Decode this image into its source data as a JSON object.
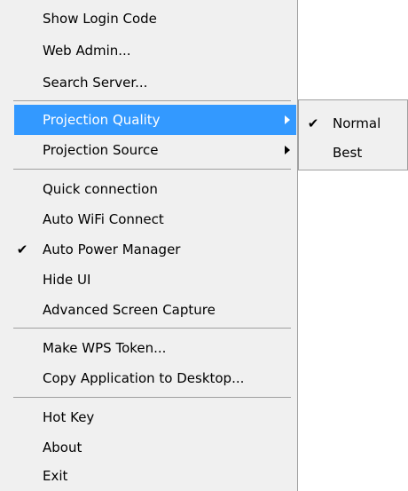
{
  "context_menu": {
    "items": [
      {
        "label": "Show Login Code"
      },
      {
        "label": "Web Admin..."
      },
      {
        "label": "Search Server..."
      },
      {
        "label": "Projection Quality"
      },
      {
        "label": "Projection Source"
      },
      {
        "label": "Quick connection"
      },
      {
        "label": "Auto WiFi Connect"
      },
      {
        "label": "Auto Power Manager",
        "checked": true
      },
      {
        "label": "Hide UI"
      },
      {
        "label": "Advanced Screen Capture"
      },
      {
        "label": "Make WPS Token..."
      },
      {
        "label": "Copy Application to Desktop..."
      },
      {
        "label": "Hot Key"
      },
      {
        "label": "About"
      },
      {
        "label": "Exit"
      }
    ],
    "check_glyph": "✔",
    "highlight_color": "#3399ff"
  },
  "submenu": {
    "items": [
      {
        "label": "Normal",
        "checked": true
      },
      {
        "label": "Best"
      }
    ],
    "check_glyph": "✔"
  }
}
